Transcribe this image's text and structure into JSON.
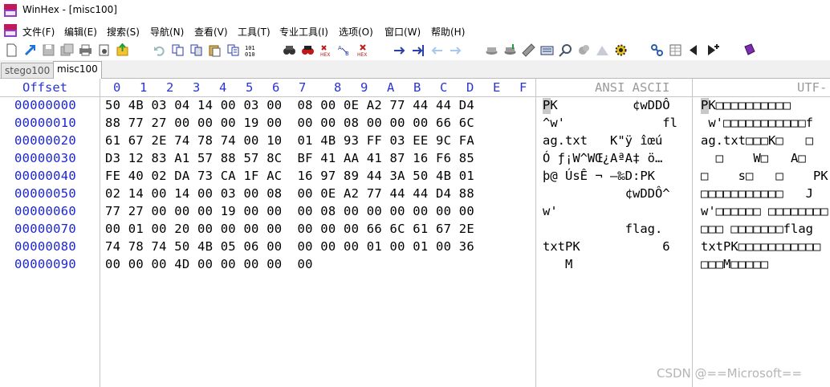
{
  "window": {
    "title": "WinHex - [misc100]"
  },
  "menu": {
    "items": [
      "文件(F)",
      "编辑(E)",
      "搜索(S)",
      "导航(N)",
      "查看(V)",
      "工具(T)",
      "专业工具(I)",
      "选项(O)",
      "窗口(W)",
      "帮助(H)"
    ]
  },
  "tabs": {
    "items": [
      "stego100",
      "misc100"
    ],
    "active": "misc100"
  },
  "header": {
    "offset": "Offset",
    "columns": [
      "0",
      "1",
      "2",
      "3",
      "4",
      "5",
      "6",
      "7",
      "8",
      "9",
      "A",
      "B",
      "C",
      "D",
      "E",
      "F"
    ],
    "ansi": "ANSI ASCII",
    "utf": "UTF-"
  },
  "rows": [
    {
      "offset": "00000000",
      "hex": "50 4B 03 04 14 00 03 00  08 00 0E A2 77 44 44 D4",
      "ansi": "PK          ¢wDDÔ",
      "utf": "PK□□□□□□□□□□"
    },
    {
      "offset": "00000010",
      "hex": "88 77 27 00 00 00 19 00  00 00 08 00 00 00 66 6C",
      "ansi": "^w'             fl",
      "utf": " w'□□□□□□□□□□□f"
    },
    {
      "offset": "00000020",
      "hex": "61 67 2E 74 78 74 00 10  01 4B 93 FF 03 EE 9C FA",
      "ansi": "ag.txt   K\"ÿ îœú",
      "utf": "ag.txt□□□K□   □"
    },
    {
      "offset": "00000030",
      "hex": "D3 12 83 A1 57 88 57 8C  BF 41 AA 41 87 16 F6 85",
      "ansi": "Ó ƒ¡W^WŒ¿AªA‡ ö…",
      "utf": "  □    W□   A□"
    },
    {
      "offset": "00000040",
      "hex": "FE 40 02 DA 73 CA 1F AC  16 97 89 44 3A 50 4B 01",
      "ansi": "þ@ ÚsÊ ¬ —‰D:PK",
      "utf": "□    s□   □    PK"
    },
    {
      "offset": "00000050",
      "hex": "02 14 00 14 00 03 00 08  00 0E A2 77 44 44 D4 88",
      "ansi": "           ¢wDDÔ^",
      "utf": "□□□□□□□□□□□   J"
    },
    {
      "offset": "00000060",
      "hex": "77 27 00 00 00 19 00 00  00 08 00 00 00 00 00 00",
      "ansi": "w'",
      "utf": "w'□□□□□□ □□□□□□□□"
    },
    {
      "offset": "00000070",
      "hex": "00 01 00 20 00 00 00 00  00 00 00 66 6C 61 67 2E",
      "ansi": "           flag.",
      "utf": "□□□ □□□□□□□flag"
    },
    {
      "offset": "00000080",
      "hex": "74 78 74 50 4B 05 06 00  00 00 00 01 00 01 00 36",
      "ansi": "txtPK           6",
      "utf": "txtPK□□□□□□□□□□□"
    },
    {
      "offset": "00000090",
      "hex": "00 00 00 4D 00 00 00 00  00",
      "ansi": "   M",
      "utf": "□□□M□□□□□"
    }
  ],
  "watermark": "CSDN @==Microsoft==",
  "colors": {
    "offset_blue": "#1a25d6",
    "header_blue": "#2a34d6",
    "header_gray": "#9a9a9a"
  }
}
